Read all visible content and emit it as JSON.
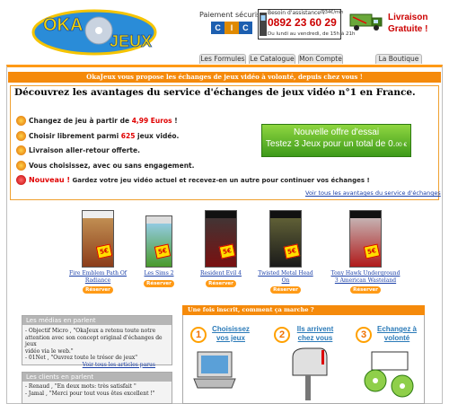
{
  "header": {
    "logo_text": [
      "OKA",
      "JEUX"
    ],
    "payment_label": "Paiement sécurisé",
    "bank": [
      "C",
      "I",
      "C"
    ],
    "assist_label": "Besoin d'assistance ?",
    "phone_cost": "0,34€/min",
    "phone": "0892 23 60 29",
    "hours": "Du lundi au vendredi, de 15h à 21h",
    "free_shipping": [
      "Livraison",
      "Gratuite !"
    ]
  },
  "tabs": [
    "Les Formules",
    "Le Catalogue",
    "Mon Compte",
    "La Boutique"
  ],
  "banner": "OkaJeux vous propose les échanges de jeux vidéo à volonté, depuis chez vous !",
  "promo": {
    "title": "Découvrez les avantages du service d'échanges de jeux vidéo n°1 en France.",
    "bullets": [
      {
        "pre": "Changez de jeu à partir de ",
        "hl": "4,99 Euros",
        "post": " !"
      },
      {
        "pre": "Choisir librement parmi ",
        "hl": "625",
        "post": " jeux vidéo."
      },
      {
        "pre": "Livraison aller-retour offerte.",
        "hl": "",
        "post": ""
      },
      {
        "pre": "Vous choisissez, avec ou sans engagement.",
        "hl": "",
        "post": ""
      },
      {
        "pre": "",
        "hl": "Nouveau !",
        "post": " Gardez votre jeu vidéo actuel et recevez-en un autre pour continuer vos échanges !"
      }
    ],
    "offer_line1": "Nouvelle offre d'essai",
    "offer_line2": "Testez 3 Jeux pour un total de 0.",
    "offer_price_suffix": "00 €",
    "see_all": "Voir tous les avantages du service d'échanges"
  },
  "games": [
    {
      "name": "Fire Emblem Path Of Radiance",
      "price": "5€",
      "color": "#8c3d1a",
      "reserve": "Réserver"
    },
    {
      "name": "Les Sims 2",
      "price": "5€",
      "color": "#4a9a2c",
      "reserve": "Réserver"
    },
    {
      "name": "Resident Evil 4",
      "price": "5€",
      "color": "#7a1010",
      "reserve": "Réserver"
    },
    {
      "name": "Twisted Metal Head On",
      "price": "5€",
      "color": "#3a3a3a",
      "reserve": "Réserver"
    },
    {
      "name": "Tony Hawk Underground 3 American Wasteland",
      "price": "5€",
      "color": "#b01a1a",
      "reserve": "Réserver"
    }
  ],
  "media": {
    "title": "Les médias en parlent",
    "lines": [
      "- Objectif Micro , \"OkaJeux a retenu toute notre",
      "attention avec son concept original d'échanges de jeux",
      "vidéo via le web.\"",
      "- 01Net , \"Ouvrez toute le trésor de jeux\""
    ],
    "link": "Voir tous les articles parus"
  },
  "clients": {
    "title": "Les clients en parlent",
    "lines": [
      "- Renaud , \"En deux mots: très satisfait \"",
      "- Jamal , \"Merci pour tout vous êtes excellent !\""
    ]
  },
  "how": {
    "title": "Une fois inscrit, comment ça marche ?",
    "steps": [
      {
        "num": "1",
        "title": [
          "Choisissez",
          "vos jeux"
        ]
      },
      {
        "num": "2",
        "title": [
          "Ils arrivent",
          "chez vous"
        ]
      },
      {
        "num": "3",
        "title": [
          "Echangez à",
          "volonté"
        ]
      }
    ]
  }
}
